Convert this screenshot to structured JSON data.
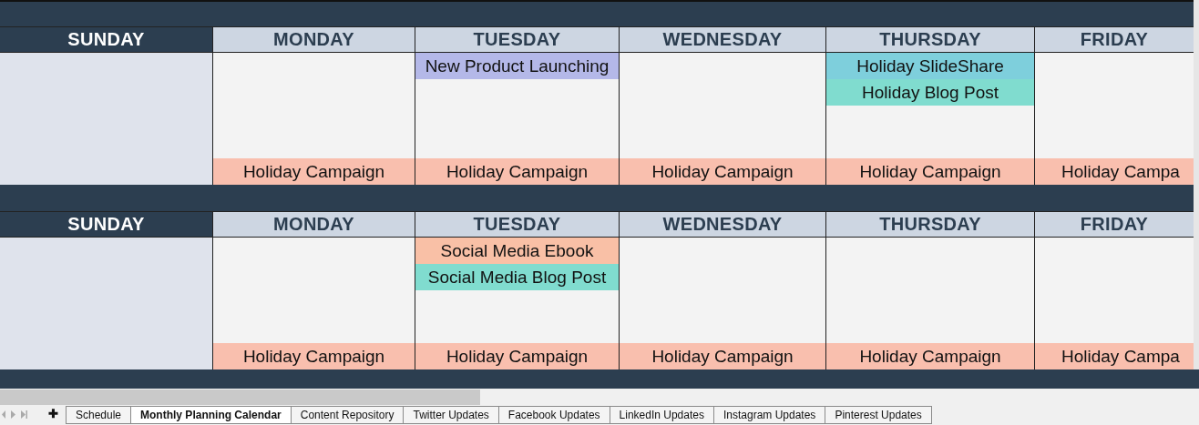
{
  "weeks": [
    {
      "days": [
        {
          "name": "SUNDAY",
          "kind": "weekend"
        },
        {
          "name": "MONDAY",
          "kind": "weekday",
          "campaign": {
            "label": "Holiday Campaign",
            "color": "#f9bfae"
          }
        },
        {
          "name": "TUESDAY",
          "kind": "weekday",
          "events": [
            {
              "label": "New Product Launching",
              "color": "#b4b8e8"
            }
          ],
          "campaign": {
            "label": "Holiday Campaign",
            "color": "#f9bfae"
          }
        },
        {
          "name": "WEDNESDAY",
          "kind": "weekday",
          "campaign": {
            "label": "Holiday Campaign",
            "color": "#f9bfae"
          }
        },
        {
          "name": "THURSDAY",
          "kind": "weekday",
          "events": [
            {
              "label": "Holiday SlideShare",
              "color": "#7ecfdc"
            },
            {
              "label": "Holiday Blog Post",
              "color": "#80dccf"
            }
          ],
          "campaign": {
            "label": "Holiday Campaign",
            "color": "#f9bfae"
          }
        },
        {
          "name": "FRIDAY",
          "kind": "weekday",
          "campaign": {
            "label": "Holiday Campa",
            "color": "#f9bfae"
          }
        }
      ]
    },
    {
      "days": [
        {
          "name": "SUNDAY",
          "kind": "weekend"
        },
        {
          "name": "MONDAY",
          "kind": "weekday",
          "campaign": {
            "label": "Holiday Campaign",
            "color": "#f9bfae"
          }
        },
        {
          "name": "TUESDAY",
          "kind": "weekday",
          "events": [
            {
              "label": "Social Media Ebook",
              "color": "#f9c0a6"
            },
            {
              "label": "Social Media Blog Post",
              "color": "#80dccf"
            }
          ],
          "campaign": {
            "label": "Holiday Campaign",
            "color": "#f9bfae"
          }
        },
        {
          "name": "WEDNESDAY",
          "kind": "weekday",
          "campaign": {
            "label": "Holiday Campaign",
            "color": "#f9bfae"
          }
        },
        {
          "name": "THURSDAY",
          "kind": "weekday",
          "campaign": {
            "label": "Holiday Campaign",
            "color": "#f9bfae"
          }
        },
        {
          "name": "FRIDAY",
          "kind": "weekday",
          "campaign": {
            "label": "Holiday Campa",
            "color": "#f9bfae"
          }
        }
      ]
    }
  ],
  "add_sheet": "✚",
  "sheet_tabs": [
    {
      "label": "Schedule",
      "selected": false
    },
    {
      "label": "Monthly Planning Calendar",
      "selected": true
    },
    {
      "label": "Content Repository",
      "selected": false
    },
    {
      "label": "Twitter Updates",
      "selected": false
    },
    {
      "label": "Facebook Updates",
      "selected": false
    },
    {
      "label": "LinkedIn Updates",
      "selected": false
    },
    {
      "label": "Instagram Updates",
      "selected": false
    },
    {
      "label": "Pinterest Updates",
      "selected": false
    }
  ]
}
